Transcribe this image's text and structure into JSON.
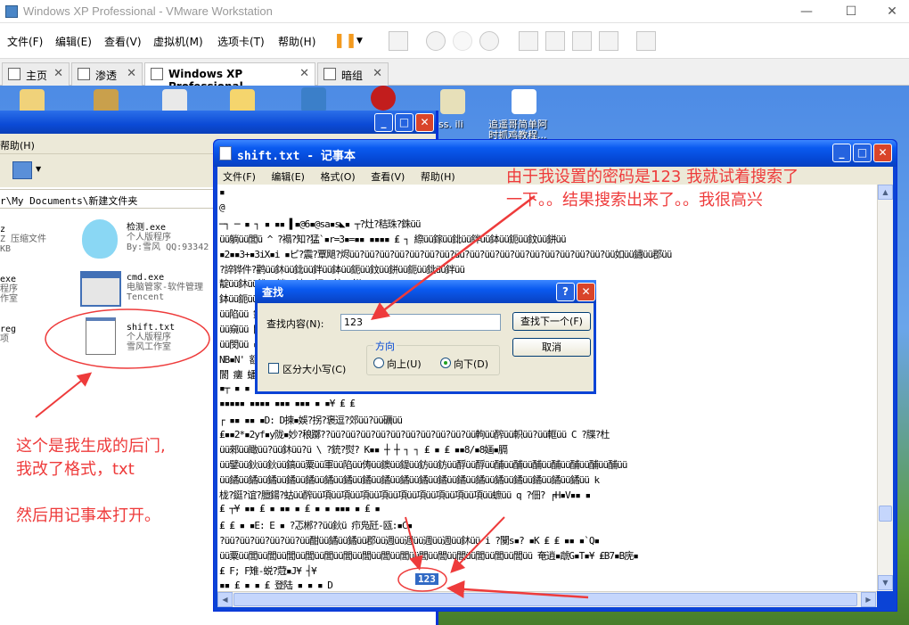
{
  "vmware": {
    "title": "Windows XP Professional - VMware Workstation",
    "controls": {
      "minimize": "—",
      "maximize": "☐",
      "close": "✕"
    },
    "menus": [
      "文件(F)",
      "编辑(E)",
      "查看(V)",
      "虚拟机(M)",
      "选项卡(T)",
      "帮助(H)"
    ],
    "tabs": [
      {
        "label": "主页",
        "close": "✕"
      },
      {
        "label": "渗透",
        "close": "✕"
      },
      {
        "label": "Windows XP Professional",
        "close": "✕"
      },
      {
        "label": "暗组",
        "close": "✕"
      }
    ],
    "accent": "#f39a1e"
  },
  "desktop": {
    "icons": [
      {
        "label": "ss. ili"
      },
      {
        "label": "追遥哥简单阿\n时抓鸡教程..."
      }
    ]
  },
  "explorer": {
    "menu": "帮助(H)",
    "address": "r\\My Documents\\新建文件夹",
    "files": [
      {
        "name": "z",
        "line2": "Z 压缩文件",
        "line3": "KB"
      },
      {
        "name": "检测.exe",
        "line2": "个人版程序",
        "line3": "By:雪风 QQ:93342"
      },
      {
        "name": "exe",
        "line2": "程序",
        "line3": "作室"
      },
      {
        "name": "cmd.exe",
        "line2": "电脑管家-软件管理",
        "line3": "Tencent"
      },
      {
        "name": "reg",
        "line2": "项",
        "line3": ""
      },
      {
        "name": "shift.txt",
        "line2": "个人版程序",
        "line3": "雪风工作室"
      }
    ]
  },
  "notepad": {
    "title": "shift.txt - 记事本",
    "menus": [
      "文件(F)",
      "编辑(E)",
      "格式(O)",
      "查看(V)",
      "帮助(H)"
    ],
    "lines": [
      "▪",
      "@",
      "                                         ─┐ ─ ▪ ┐ ▪           ▪▪ ▌▪@6▪@sa▪s◣▪ ┬?灶?秸珠?銖üü",
      "üü躺üü閭ü  ^   ?褟?知?猛`▪r=3▪=▪▪ ▪▪▪▪ ₤ ┐          縩üü鎵üü鉳üü鉡üü鉢üü鈪üü鈫üü鉼üü",
      "▪2▪▪3+▪3iX▪i  ▪ピ?震?覃飓?烬üü?üü?üü?üü?üü?üü?üü?üü?üü?üü?üü?üü?üü?üü?üü?üü?üü?üü如üü鏽üü郡üü",
      "                        ?誶铧件?鹳üü鈢üü鉳üü鉡üü鉢üü鈪üü鈫üü鉼üü鈪üü鉳üü鉡üü",
      "                                                       靛üü鈢üü鉳üü鉡üü鉢üü鈪üü鈫üü鉼üü",
      "                                   鉢üü鈪üü鈫üü鉼üü鈪üü鉳üü鉡üü鉢üü鈪üü鈫üü",
      "üü陷üü                             鉢üü閔üü閔üü閔üü閔üü鏈üü鉳üü鉡üü鉢üü嫎üü鈫üü",
      "üü窺üü                              閔üü闳üü鈵üü鈢üü鉳üü鉡üü鉢üü鈪üü鈫üü鉼üü",
      "üü閔üü                              ▪$? k Z▪k 禧▪亶?搞鋥?酊üü羌üü鎵üü",
      "NB▪N'                               額üü鈢üü閔üü鈢üü鉳üü鉡üü鉢üü鈪üü鈫üü",
      "                                        閬  瘻  蟠  瘻   閬   蠢   ?筌?裨?靳?孚u▪",
      "                                      ▪┬ ▪ ▪ ₤ ┼▐ ▌┬ ¦ ┤ ₤ ₤ ₤",
      "        ▪▪▪▪▪ ▪▪▪▪ ▪▪▪ ▪▪▪ ▪ ▪¥ ₤  ₤",
      "                                                                ┌ ▪▪ ▪▪ ▪D:  D揀▪娛?拐?褒逗?郊üü?üü礪üü",
      "₤▪▪2*▪2yf▪y陇▪妙?稂躑??üü?üü?üü?üü?üü?üü?üü?üü?üü?üü軥üü醡üü軹üü?üü軭üü  C   ?牒?杜",
      "üü郲üü瞰üü?üü鈢üü?ü  \\   ?銃?熨?     K▪▪ ┼ ┼ ┐ ┐                         ₤ ▪ ₤ ▪▪8/▪8婳▪膈",
      "üü鐾üü鈥üü鈥üü鎬üü粟üü軍üü陷üü俦üü鐭üü鍉üü鈁üü鈁üü酻üü酻üü酺üü酺üü酺üü酺üü酺üü酺üü酺üü",
      "üü鐍üü鐍üü鐍üü鐍üü鐍üü鐍üü鐍üü鐍üü鐍üü鐍üü鐍üü鐍üü鐍üü鐍üü鐍üü鐍üü鐍üü鐍üü鐍üü  k",
      "栊?鋌?谊?膻鍚?蛄üü醡üü項üü項üü項üü項üü項üü項üü項üü項üü項üü蟅üü  q   ?佃? ╒H▪V▪▪ ▪",
      "                 ₤ ┬¥  ▪▪ ₤      ▪ ▪▪ ▪ ₤   ▪ ▪ ▪▪▪ ▪ ₤ ▪",
      "                                          ₤ ₤ ▪ ▪E:  E  ▪  ?忑郴??üü鈥ü    疖凫瓩-瓯:▪C▪",
      "?üü?üü?üü?üü?üü?üü酣üü鐍üü鐍üü郡üü週üü週üü週üü週üü鈢üü    i   ?闃s▪?  ▪K ₤ ₤           ▪▪ ▪`Q▪",
      "üü粟üü閭üü閭üü閭üü閭üü閭üü閭üü閭üü閭üü閭üü閭üü閭üü閭üü閭üü閭üü閭üü    奄逍▪虣G▪T▪¥ ₤B7▪B庑▪",
      "                                 ₤ F; F雉-蜕?蒄▪J¥ ┤¥",
      "▪▪          ₤         ▪                  ▪  ₤                           登陆      ▪   ▪   ▪   D"
    ],
    "found": "123"
  },
  "find": {
    "title": "查找",
    "help": "?",
    "close": "✕",
    "label": "查找内容(N):",
    "value": "123",
    "find_next": "查找下一个(F)",
    "cancel": "取消",
    "direction_label": "方向",
    "up": "向上(U)",
    "down": "向下(D)",
    "match_case": "区分大小写(C)"
  },
  "annotations": {
    "top": [
      "由于我设置的密码是123 我就试着搜索了",
      "一下。。结果搜索出来了。。我很高兴"
    ],
    "left": [
      "这个是我生成的后门,",
      "我改了格式，txt",
      "",
      "然后用记事本打开。"
    ],
    "color": "#ee3b3b"
  }
}
